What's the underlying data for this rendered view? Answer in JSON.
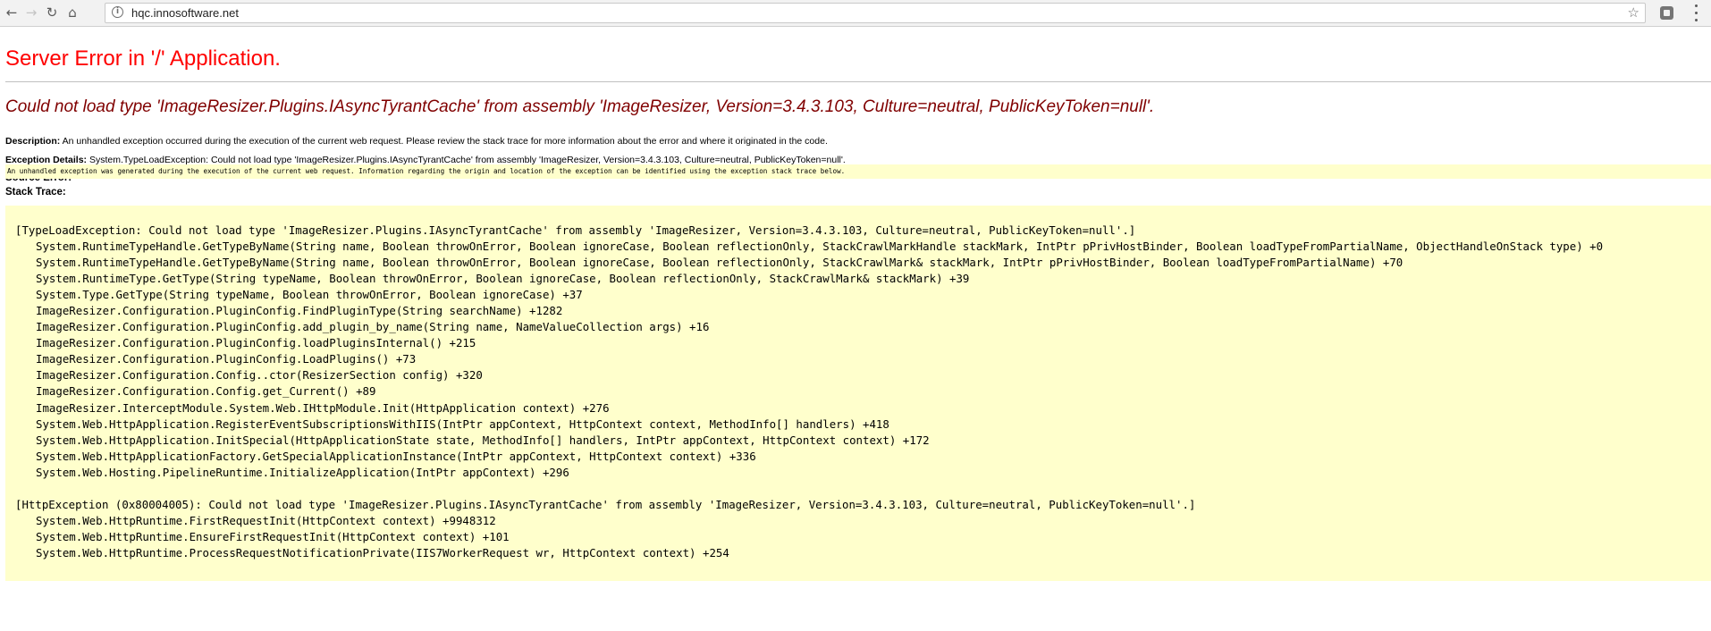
{
  "browser": {
    "url": "hqc.innosoftware.net",
    "back_glyph": "←",
    "forward_glyph": "→",
    "reload_glyph": "↻",
    "home_glyph": "⌂",
    "info_glyph": "i",
    "star_glyph": "☆"
  },
  "page": {
    "title": "Server Error in '/' Application.",
    "error_message": "Could not load type 'ImageResizer.Plugins.IAsyncTyrantCache' from assembly 'ImageResizer, Version=3.4.3.103, Culture=neutral, PublicKeyToken=null'.",
    "description_label": "Description:",
    "description_text": "An unhandled exception occurred during the execution of the current web request. Please review the stack trace for more information about the error and where it originated in the code.",
    "exception_label": "Exception Details:",
    "exception_text": "System.TypeLoadException: Could not load type 'ImageResizer.Plugins.IAsyncTyrantCache' from assembly 'ImageResizer, Version=3.4.3.103, Culture=neutral, PublicKeyToken=null'.",
    "source_error_label": "Source Error:",
    "source_error_text": "An unhandled exception was generated during the execution of the current web request. Information regarding the origin and location of the exception can be identified using the exception stack trace below.",
    "stack_trace_label": "Stack Trace:"
  },
  "stack_trace": {
    "header1": "[TypeLoadException: Could not load type 'ImageResizer.Plugins.IAsyncTyrantCache' from assembly 'ImageResizer, Version=3.4.3.103, Culture=neutral, PublicKeyToken=null'.]",
    "frames1": [
      "System.RuntimeTypeHandle.GetTypeByName(String name, Boolean throwOnError, Boolean ignoreCase, Boolean reflectionOnly, StackCrawlMarkHandle stackMark, IntPtr pPrivHostBinder, Boolean loadTypeFromPartialName, ObjectHandleOnStack type) +0",
      "System.RuntimeTypeHandle.GetTypeByName(String name, Boolean throwOnError, Boolean ignoreCase, Boolean reflectionOnly, StackCrawlMark& stackMark, IntPtr pPrivHostBinder, Boolean loadTypeFromPartialName) +70",
      "System.RuntimeType.GetType(String typeName, Boolean throwOnError, Boolean ignoreCase, Boolean reflectionOnly, StackCrawlMark& stackMark) +39",
      "System.Type.GetType(String typeName, Boolean throwOnError, Boolean ignoreCase) +37",
      "ImageResizer.Configuration.PluginConfig.FindPluginType(String searchName) +1282",
      "ImageResizer.Configuration.PluginConfig.add_plugin_by_name(String name, NameValueCollection args) +16",
      "ImageResizer.Configuration.PluginConfig.loadPluginsInternal() +215",
      "ImageResizer.Configuration.PluginConfig.LoadPlugins() +73",
      "ImageResizer.Configuration.Config..ctor(ResizerSection config) +320",
      "ImageResizer.Configuration.Config.get_Current() +89",
      "ImageResizer.InterceptModule.System.Web.IHttpModule.Init(HttpApplication context) +276",
      "System.Web.HttpApplication.RegisterEventSubscriptionsWithIIS(IntPtr appContext, HttpContext context, MethodInfo[] handlers) +418",
      "System.Web.HttpApplication.InitSpecial(HttpApplicationState state, MethodInfo[] handlers, IntPtr appContext, HttpContext context) +172",
      "System.Web.HttpApplicationFactory.GetSpecialApplicationInstance(IntPtr appContext, HttpContext context) +336",
      "System.Web.Hosting.PipelineRuntime.InitializeApplication(IntPtr appContext) +296"
    ],
    "header2": "[HttpException (0x80004005): Could not load type 'ImageResizer.Plugins.IAsyncTyrantCache' from assembly 'ImageResizer, Version=3.4.3.103, Culture=neutral, PublicKeyToken=null'.]",
    "frames2": [
      "System.Web.HttpRuntime.FirstRequestInit(HttpContext context) +9948312",
      "System.Web.HttpRuntime.EnsureFirstRequestInit(HttpContext context) +101",
      "System.Web.HttpRuntime.ProcessRequestNotificationPrivate(IIS7WorkerRequest wr, HttpContext context) +254"
    ]
  }
}
